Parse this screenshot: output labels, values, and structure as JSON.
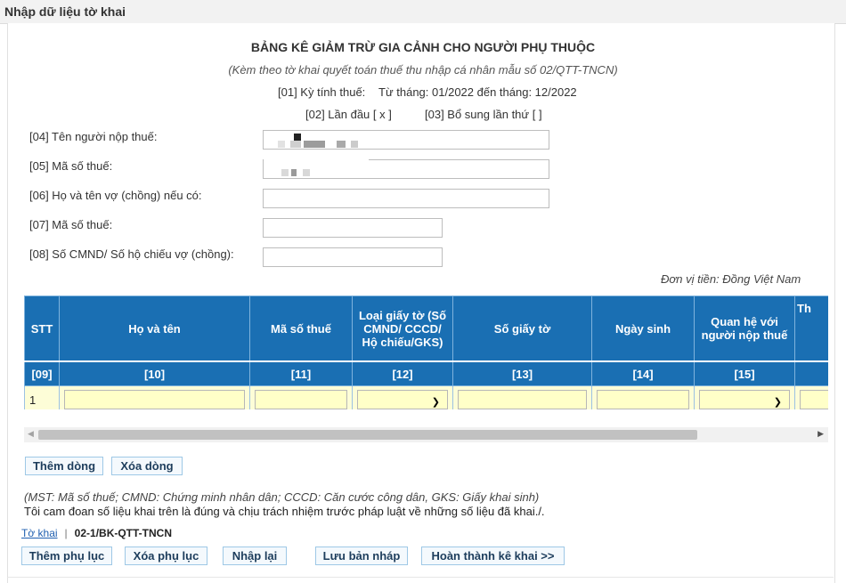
{
  "window": {
    "title": "Nhập dữ liệu tờ khai"
  },
  "form": {
    "title": "BẢNG KÊ GIẢM TRỪ GIA CẢNH CHO NGƯỜI PHỤ THUỘC",
    "subtitle": "(Kèm theo tờ khai quyết toán thuế thu nhập cá nhân mẫu số 02/QTT-TNCN)",
    "period_label": "[01] Kỳ tính thuế:",
    "period_value": "Từ tháng: 01/2022 đến tháng: 12/2022",
    "first_time": "[02] Lần đầu [ x ]",
    "supplement": "[03] Bổ sung lần thứ   [ ]",
    "fields": {
      "taxpayer_name": {
        "label": "[04] Tên người nộp thuế:",
        "value": ""
      },
      "tax_code": {
        "label": "[05] Mã số thuế:",
        "value": ""
      },
      "spouse_name": {
        "label": "[06] Họ và tên vợ (chồng) nếu có:",
        "value": ""
      },
      "spouse_tax_code": {
        "label": "[07] Mã số thuế:",
        "value": ""
      },
      "spouse_id": {
        "label": "[08] Số CMND/ Số hộ chiếu vợ (chồng):",
        "value": ""
      }
    },
    "currency_unit": "Đơn vị tiền: Đồng Việt Nam"
  },
  "grid": {
    "headers": [
      "STT",
      "Họ và tên",
      "Mã số thuế",
      "Loại giấy tờ (Số CMND/ CCCD/ Hộ chiếu/GKS)",
      "Số giấy tờ",
      "Ngày sinh",
      "Quan hệ với người nộp thuế",
      "Th"
    ],
    "codes": [
      "[09]",
      "[10]",
      "[11]",
      "[12]",
      "[13]",
      "[14]",
      "[15]",
      ""
    ],
    "rows": [
      {
        "stt": "1",
        "name": "",
        "tax_code": "",
        "doc_type": "",
        "doc_number": "",
        "dob": "",
        "relation": ""
      }
    ]
  },
  "buttons": {
    "add_row": "Thêm dòng",
    "delete_row": "Xóa dòng",
    "add_appendix": "Thêm phụ lục",
    "delete_appendix": "Xóa phụ lục",
    "reenter": "Nhập lại",
    "save_draft": "Lưu bản nháp",
    "finish": "Hoàn thành kê khai >>"
  },
  "notes": {
    "abbrev": "(MST: Mã số thuế; CMND: Chứng minh nhân dân; CCCD: Căn cước công dân, GKS: Giấy khai sinh)",
    "commitment": "Tôi cam đoan số liệu khai trên là đúng và chịu trách nhiệm trước pháp luật về những số liệu đã khai./."
  },
  "tabs": {
    "declaration_link": "Tờ khai",
    "separator": "|",
    "current_form": "02-1/BK-QTT-TNCN"
  },
  "colors": {
    "grid_header": "#1a6fb3",
    "input_row": "#fdfdd7",
    "button_border": "#9ec8e6"
  }
}
